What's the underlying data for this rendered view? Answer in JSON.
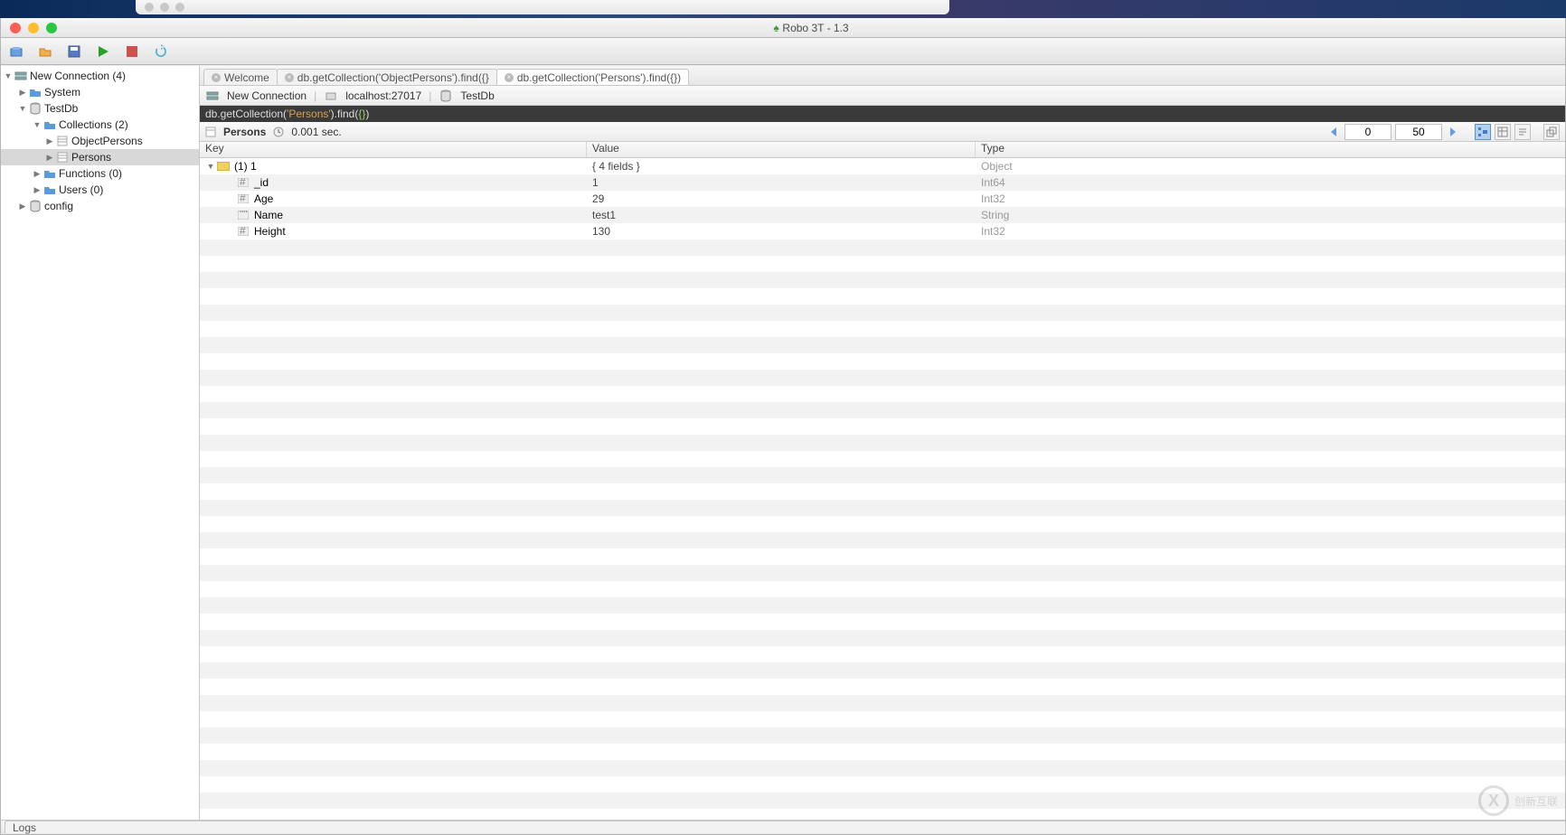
{
  "window": {
    "title": "Robo 3T - 1.3"
  },
  "toolbar": {},
  "sidebar": {
    "root": "New Connection (4)",
    "items": [
      {
        "label": "System"
      },
      {
        "label": "TestDb"
      },
      {
        "label": "Collections (2)"
      },
      {
        "label": "ObjectPersons"
      },
      {
        "label": "Persons"
      },
      {
        "label": "Functions (0)"
      },
      {
        "label": "Users (0)"
      },
      {
        "label": "config"
      }
    ]
  },
  "tabs": [
    {
      "label": "Welcome"
    },
    {
      "label": "db.getCollection('ObjectPersons').find({}"
    },
    {
      "label": "db.getCollection('Persons').find({})"
    }
  ],
  "breadcrumb": {
    "connection": "New Connection",
    "host": "localhost:27017",
    "db": "TestDb"
  },
  "query_plain": "db.getCollection('Persons').find({})",
  "result": {
    "collection": "Persons",
    "time": "0.001 sec.",
    "paging": {
      "skip": "0",
      "limit": "50"
    }
  },
  "columns": {
    "key": "Key",
    "val": "Value",
    "typ": "Type"
  },
  "rows": [
    {
      "indent": 0,
      "twisty": "▼",
      "icon": "obj",
      "key": "(1) 1",
      "val": "{ 4 fields }",
      "typ": "Object"
    },
    {
      "indent": 1,
      "twisty": "",
      "icon": "num",
      "key": "_id",
      "val": "1",
      "typ": "Int64"
    },
    {
      "indent": 1,
      "twisty": "",
      "icon": "num",
      "key": "Age",
      "val": "29",
      "typ": "Int32"
    },
    {
      "indent": 1,
      "twisty": "",
      "icon": "str",
      "key": "Name",
      "val": "test1",
      "typ": "String"
    },
    {
      "indent": 1,
      "twisty": "",
      "icon": "num",
      "key": "Height",
      "val": "130",
      "typ": "Int32"
    }
  ],
  "status": {
    "logs": "Logs"
  }
}
